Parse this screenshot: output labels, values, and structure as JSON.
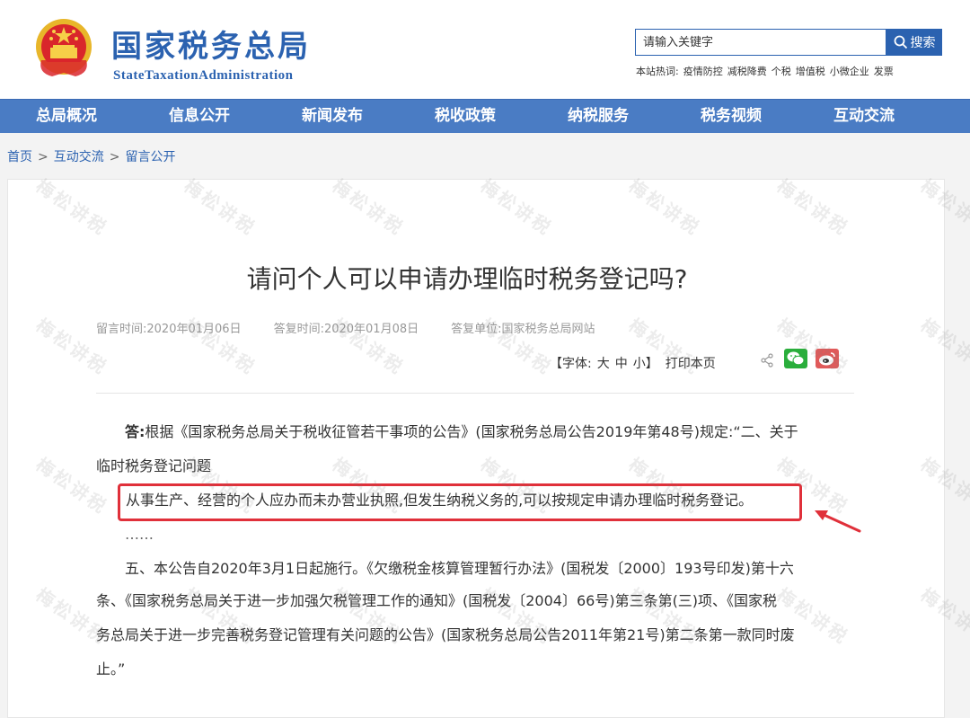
{
  "header": {
    "site_name_cn": "国家税务总局",
    "site_name_en": "StateTaxationAdministration",
    "search": {
      "placeholder": "请输入关键字",
      "button_label": "搜索"
    },
    "hot": {
      "label": "本站热词:",
      "terms": [
        "疫情防控",
        "减税降费",
        "个税",
        "增值税",
        "小微企业",
        "发票"
      ]
    }
  },
  "nav": {
    "items": [
      "总局概况",
      "信息公开",
      "新闻发布",
      "税收政策",
      "纳税服务",
      "税务视频",
      "互动交流"
    ]
  },
  "breadcrumb": {
    "items": [
      "首页",
      "互动交流",
      "留言公开"
    ],
    "separator": ">"
  },
  "article": {
    "title": "请问个人可以申请办理临时税务登记吗?",
    "meta": {
      "post_time": "留言时间:2020年01月06日",
      "reply_time": "答复时间:2020年01月08日",
      "reply_unit": "答复单位:国家税务总局网站"
    },
    "tools": {
      "font_label": "【字体:",
      "sizes": [
        "大",
        "中",
        "小"
      ],
      "font_close": "】",
      "print_label": "打印本页"
    },
    "body": {
      "answer_label": "答:",
      "p1_line1": "根据《国家税务总局关于税收征管若干事项的公告》(国家税务总局公告2019年第48号)规定:“二、关于",
      "p1_line2": "临时税务登记问题",
      "p2": "从事生产、经营的个人应办而未办营业执照,但发生纳税义务的,可以按规定申请办理临时税务登记。",
      "ellipsis": "……",
      "p3_line1": "五、本公告自2020年3月1日起施行。《欠缴税金核算管理暂行办法》(国税发〔2000〕193号印发)第十六",
      "p3_line2": "条、《国家税务总局关于进一步加强欠税管理工作的通知》(国税发〔2004〕66号)第三条第(三)项、《国家税",
      "p3_line3": "务总局关于进一步完善税务登记管理有关问题的公告》(国家税务总局公告2011年第21号)第二条第一款同时废",
      "p3_line4": "止。”"
    }
  },
  "watermark": {
    "text": "梅松讲税"
  },
  "colors": {
    "brand_blue": "#2b62b0",
    "nav_blue": "#4a7cc4",
    "highlight_red": "#e0303a",
    "wechat_green": "#2aae3c",
    "weibo_red": "#e05a5a"
  }
}
